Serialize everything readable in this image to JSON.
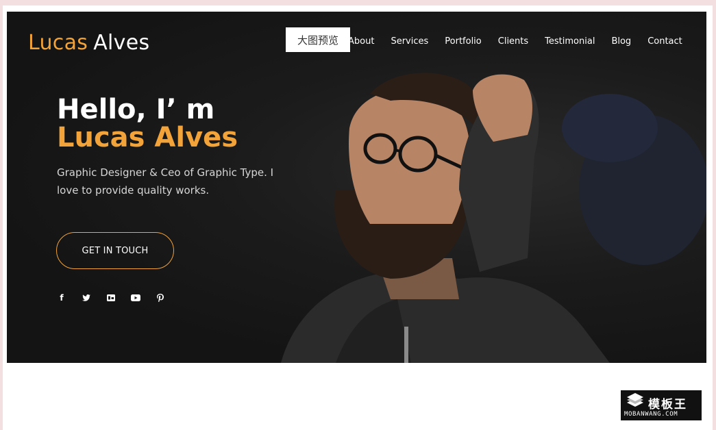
{
  "site": {
    "logo_first": "Lucas",
    "logo_last": "Alves"
  },
  "nav": {
    "items": [
      "About",
      "Services",
      "Portfolio",
      "Clients",
      "Testimonial",
      "Blog",
      "Contact"
    ]
  },
  "overlay": {
    "preview_label": "大图预览"
  },
  "hero": {
    "greeting": "Hello, I’ m",
    "name": "Lucas Alves",
    "description": "Graphic Designer & Ceo of Graphic Type. I love to provide quality works.",
    "cta_label": "GET IN TOUCH"
  },
  "social": {
    "icons": [
      "facebook-icon",
      "twitter-icon",
      "behance-icon",
      "youtube-icon",
      "pinterest-icon"
    ],
    "glyphs": [
      "f",
      "🐦",
      "Bē",
      "▶",
      "P"
    ]
  },
  "watermark": {
    "title": "模板王",
    "url": "MOBANWANG.COM"
  },
  "colors": {
    "accent": "#f2a33a",
    "hero_bg": "#161616",
    "frame_bg": "#f3dfe0"
  }
}
